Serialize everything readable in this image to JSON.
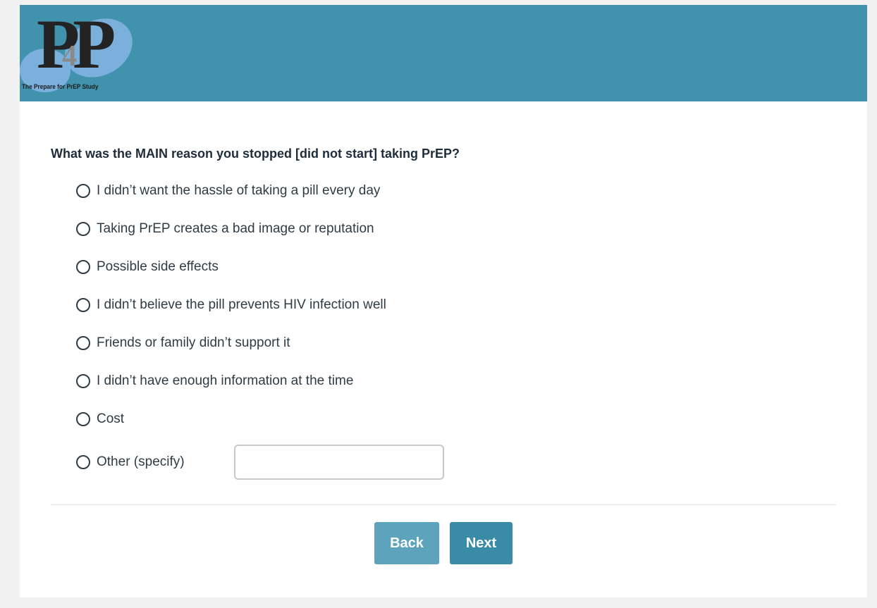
{
  "header": {
    "logo": {
      "letters": "PP",
      "number": "4",
      "caption": "The Prepare for PrEP Study"
    }
  },
  "survey": {
    "question": "What was the MAIN reason you stopped [did not start] taking PrEP?",
    "options": [
      {
        "label": "I didn’t want the hassle of taking a pill every day"
      },
      {
        "label": "Taking PrEP creates a bad image or reputation"
      },
      {
        "label": "Possible side effects"
      },
      {
        "label": "I didn’t believe the pill prevents HIV infection well"
      },
      {
        "label": "Friends or family didn’t support it"
      },
      {
        "label": "I didn’t have enough information at the time"
      },
      {
        "label": "Cost"
      },
      {
        "label": "Other (specify)"
      }
    ],
    "other_input": {
      "value": "",
      "placeholder": ""
    }
  },
  "nav": {
    "back_label": "Back",
    "next_label": "Next"
  },
  "colors": {
    "header": "#4193ad",
    "back_button": "#5ea3bc",
    "next_button": "#3a8ca6",
    "logo_blob": "#7bb0dc"
  }
}
